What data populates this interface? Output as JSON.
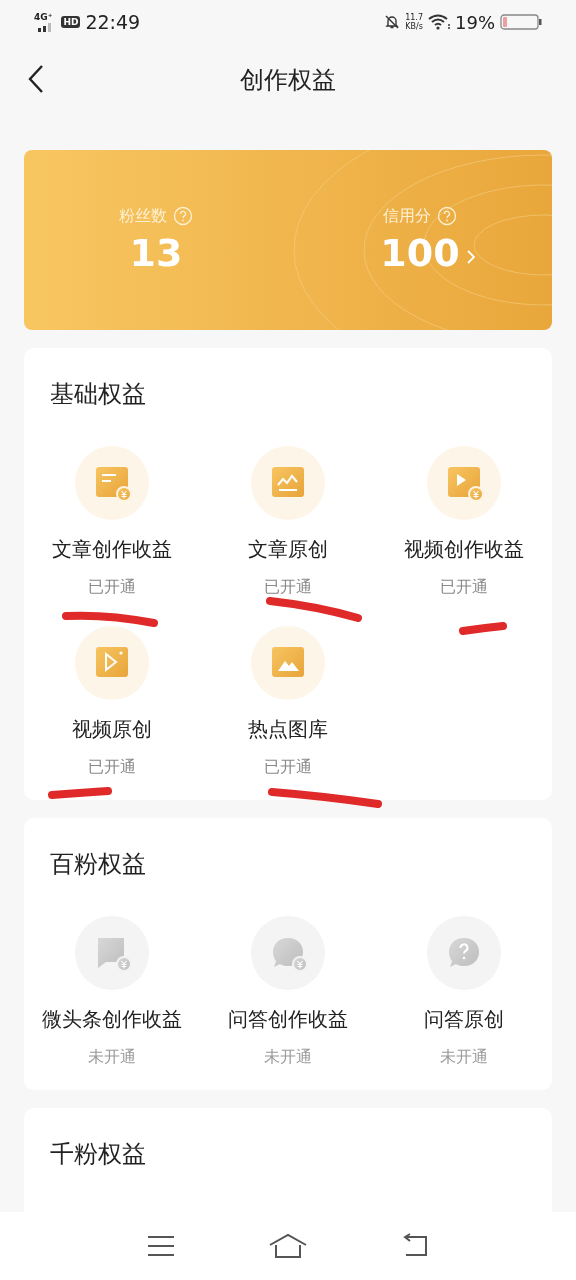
{
  "status_bar": {
    "network": "4G⁺",
    "hd": "HD",
    "time": "22:49",
    "speed_value": "11.7",
    "speed_unit": "KB/s",
    "battery": "19%"
  },
  "header": {
    "title": "创作权益"
  },
  "summary": {
    "stats": [
      {
        "label": "粉丝数",
        "value": "13",
        "has_arrow": false
      },
      {
        "label": "信用分",
        "value": "100",
        "has_arrow": true
      }
    ]
  },
  "sections": [
    {
      "title": "基础权益",
      "items": [
        {
          "kind": "doc-coin",
          "name": "文章创作收益",
          "status": "已开通",
          "enabled": true
        },
        {
          "kind": "chart",
          "name": "文章原创",
          "status": "已开通",
          "enabled": true
        },
        {
          "kind": "video-coin",
          "name": "视频创作收益",
          "status": "已开通",
          "enabled": true
        },
        {
          "kind": "video",
          "name": "视频原创",
          "status": "已开通",
          "enabled": true
        },
        {
          "kind": "image",
          "name": "热点图库",
          "status": "已开通",
          "enabled": true
        }
      ]
    },
    {
      "title": "百粉权益",
      "items": [
        {
          "kind": "flag-coin",
          "name": "微头条创作收益",
          "status": "未开通",
          "enabled": false
        },
        {
          "kind": "bubble-coin",
          "name": "问答创作收益",
          "status": "未开通",
          "enabled": false
        },
        {
          "kind": "question",
          "name": "问答原创",
          "status": "未开通",
          "enabled": false
        }
      ]
    },
    {
      "title": "千粉权益"
    }
  ]
}
